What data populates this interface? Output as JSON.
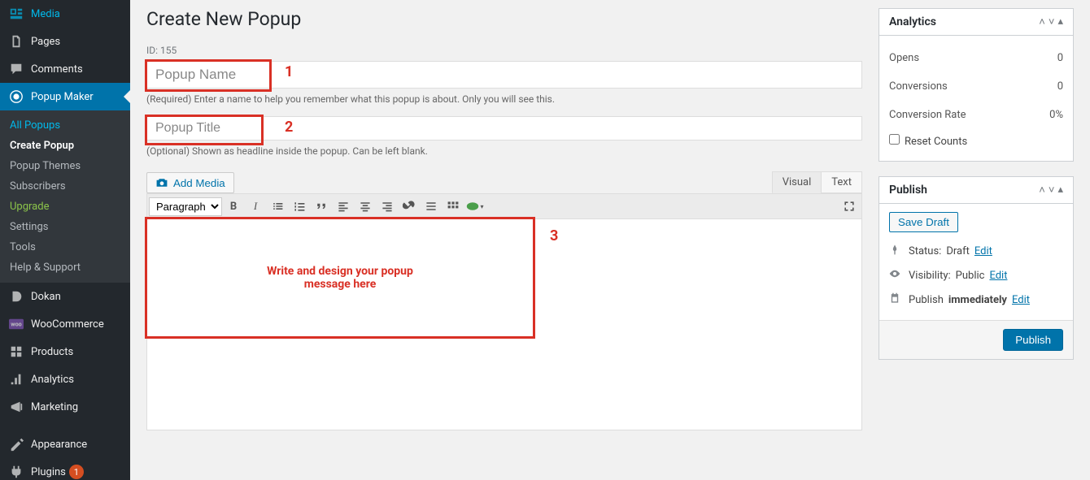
{
  "sidebar": {
    "items": [
      {
        "label": "Media",
        "icon": "media"
      },
      {
        "label": "Pages",
        "icon": "pages"
      },
      {
        "label": "Comments",
        "icon": "comments"
      },
      {
        "label": "Popup Maker",
        "icon": "popup",
        "active": true
      },
      {
        "label": "Dokan",
        "icon": "dokan"
      },
      {
        "label": "WooCommerce",
        "icon": "woo"
      },
      {
        "label": "Products",
        "icon": "products"
      },
      {
        "label": "Analytics",
        "icon": "analytics"
      },
      {
        "label": "Marketing",
        "icon": "marketing"
      },
      {
        "label": "Appearance",
        "icon": "appearance"
      },
      {
        "label": "Plugins",
        "icon": "plugins",
        "badge": "1"
      }
    ],
    "sub": [
      {
        "label": "All Popups",
        "class": "blue"
      },
      {
        "label": "Create Popup",
        "class": "current"
      },
      {
        "label": "Popup Themes"
      },
      {
        "label": "Subscribers"
      },
      {
        "label": "Upgrade",
        "class": "green"
      },
      {
        "label": "Settings"
      },
      {
        "label": "Tools"
      },
      {
        "label": "Help & Support"
      }
    ]
  },
  "page": {
    "title": "Create New Popup",
    "id_label": "ID: 155"
  },
  "fields": {
    "name_placeholder": "Popup Name",
    "name_help": "(Required) Enter a name to help you remember what this popup is about. Only you will see this.",
    "title_placeholder": "Popup Title",
    "title_help": "(Optional) Shown as headline inside the popup. Can be left blank."
  },
  "editor": {
    "add_media": "Add Media",
    "tab_visual": "Visual",
    "tab_text": "Text",
    "format": "Paragraph",
    "red_label": "Write and design your popup message here"
  },
  "analytics": {
    "title": "Analytics",
    "opens_label": "Opens",
    "opens": "0",
    "conversions_label": "Conversions",
    "conversions": "0",
    "rate_label": "Conversion Rate",
    "rate": "0%",
    "reset_label": "Reset Counts"
  },
  "publish": {
    "title": "Publish",
    "save_draft": "Save Draft",
    "status_label": "Status:",
    "status_value": "Draft",
    "status_edit": "Edit",
    "visibility_label": "Visibility:",
    "visibility_value": "Public",
    "visibility_edit": "Edit",
    "schedule_label": "Publish",
    "schedule_value": "immediately",
    "schedule_edit": "Edit",
    "button": "Publish"
  },
  "annotations": {
    "n1": "1",
    "n2": "2",
    "n3": "3"
  }
}
